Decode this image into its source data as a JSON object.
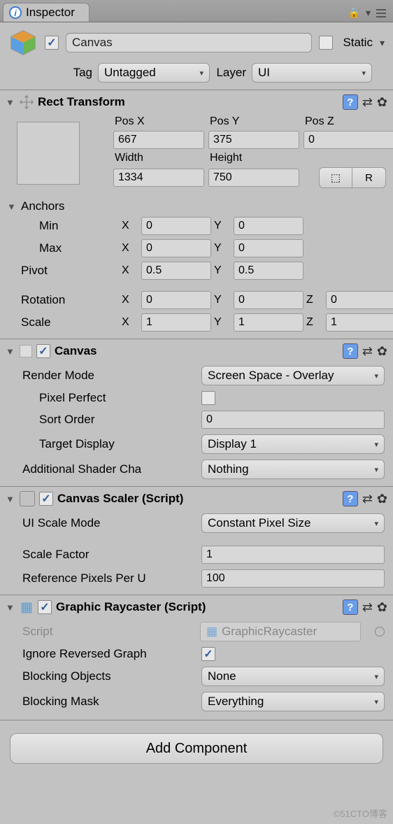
{
  "tab": {
    "title": "Inspector"
  },
  "header": {
    "name": "Canvas",
    "static_label": "Static",
    "active_checked": true,
    "tag_label": "Tag",
    "tag_value": "Untagged",
    "layer_label": "Layer",
    "layer_value": "UI"
  },
  "rect_transform": {
    "title": "Rect Transform",
    "pos_x_label": "Pos X",
    "pos_y_label": "Pos Y",
    "pos_z_label": "Pos Z",
    "pos_x": "667",
    "pos_y": "375",
    "pos_z": "0",
    "width_label": "Width",
    "height_label": "Height",
    "width": "1334",
    "height": "750",
    "reset_btn": "R",
    "anchors_label": "Anchors",
    "min_label": "Min",
    "min_x": "0",
    "min_y": "0",
    "max_label": "Max",
    "max_x": "0",
    "max_y": "0",
    "pivot_label": "Pivot",
    "pivot_x": "0.5",
    "pivot_y": "0.5",
    "rotation_label": "Rotation",
    "rot_x": "0",
    "rot_y": "0",
    "rot_z": "0",
    "scale_label": "Scale",
    "scale_x": "1",
    "scale_y": "1",
    "scale_z": "1",
    "x": "X",
    "y": "Y",
    "z": "Z"
  },
  "canvas": {
    "title": "Canvas",
    "render_mode_label": "Render Mode",
    "render_mode": "Screen Space - Overlay",
    "pixel_perfect_label": "Pixel Perfect",
    "pixel_perfect": false,
    "sort_order_label": "Sort Order",
    "sort_order": "0",
    "target_display_label": "Target Display",
    "target_display": "Display 1",
    "shader_channels_label": "Additional Shader Cha",
    "shader_channels": "Nothing"
  },
  "canvas_scaler": {
    "title": "Canvas Scaler (Script)",
    "ui_scale_mode_label": "UI Scale Mode",
    "ui_scale_mode": "Constant Pixel Size",
    "scale_factor_label": "Scale Factor",
    "scale_factor": "1",
    "ref_pixels_label": "Reference Pixels Per U",
    "ref_pixels": "100"
  },
  "raycaster": {
    "title": "Graphic Raycaster (Script)",
    "script_label": "Script",
    "script_value": "GraphicRaycaster",
    "ignore_reversed_label": "Ignore Reversed Graph",
    "ignore_reversed": true,
    "blocking_objects_label": "Blocking Objects",
    "blocking_objects": "None",
    "blocking_mask_label": "Blocking Mask",
    "blocking_mask": "Everything"
  },
  "add_component": "Add Component",
  "watermark": "©51CTO博客"
}
